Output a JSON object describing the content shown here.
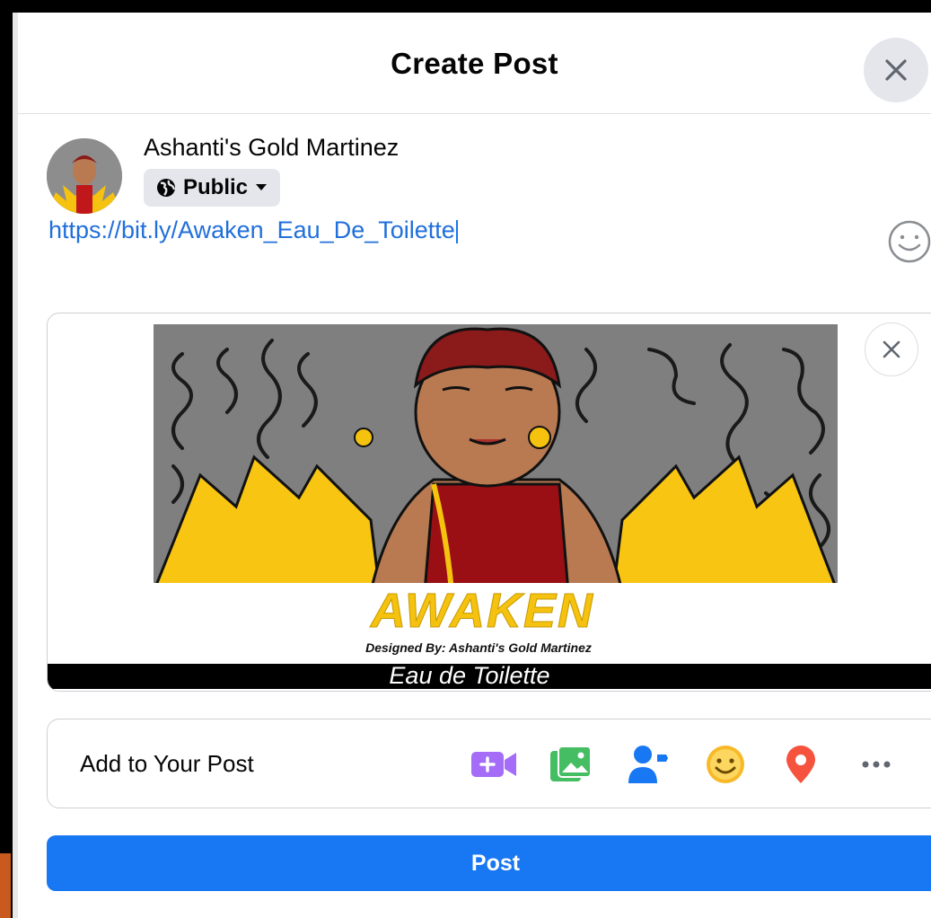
{
  "dialog": {
    "title": "Create Post",
    "close_icon": "close-icon"
  },
  "author": {
    "name": "Ashanti's Gold Martinez",
    "audience_label": "Public",
    "audience_icon": "globe-icon"
  },
  "composer": {
    "text": "https://bit.ly/Awaken_Eau_De_Toilette",
    "emoji_icon": "smile-icon"
  },
  "link_preview": {
    "brand": "AWAKEN",
    "designer": "Designed By: Ashanti's Gold Martinez",
    "product": "Eau de Toilette",
    "close_icon": "close-icon"
  },
  "add_to_post": {
    "label": "Add to Your Post",
    "tools": [
      "live-video-icon",
      "photo-icon",
      "tag-people-icon",
      "feeling-icon",
      "location-icon",
      "more-icon"
    ]
  },
  "actions": {
    "post_label": "Post"
  },
  "colors": {
    "primary": "#1877f2",
    "link": "#216fdb",
    "video": "#a56cf8",
    "photo": "#45bd62",
    "tag": "#1877f2",
    "feeling": "#f7b928",
    "location": "#f02849"
  }
}
